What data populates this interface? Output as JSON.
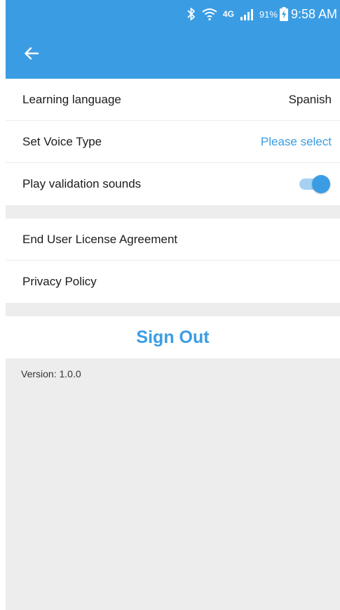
{
  "status_bar": {
    "icons": [
      "bluetooth-icon",
      "wifi-icon",
      "lte-icon",
      "signal-icon",
      "battery-charging-icon"
    ],
    "network_label": "4G",
    "battery_percent": "91%",
    "time": "9:58 AM"
  },
  "app_bar": {
    "back_icon": "arrow-left-icon",
    "background_color": "#3a9de4"
  },
  "settings": {
    "rows": [
      {
        "label": "Learning language",
        "value": "Spanish"
      },
      {
        "label": "Set Voice Type",
        "value": "Please select"
      },
      {
        "label": "Play validation sounds",
        "toggle_on": true
      }
    ]
  },
  "legal": {
    "rows": [
      {
        "label": "End User License Agreement"
      },
      {
        "label": "Privacy Policy"
      }
    ]
  },
  "sign_out_label": "Sign Out",
  "version_text": "Version: 1.0.0",
  "colors": {
    "accent": "#3a9de4",
    "background": "#ededed",
    "text": "#1c1c1c"
  }
}
